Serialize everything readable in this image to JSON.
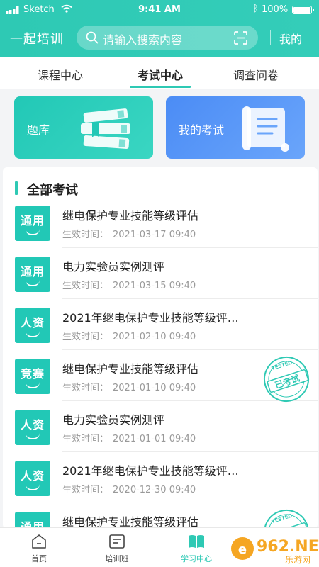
{
  "status_bar": {
    "carrier": "Sketch",
    "time": "9:41 AM",
    "battery": "100%",
    "icons": [
      "signal-icon",
      "wifi-icon",
      "bluetooth-icon",
      "battery-icon"
    ]
  },
  "header": {
    "title": "一起培训",
    "search_placeholder": "请输入搜索内容",
    "mine": "我的",
    "icons": [
      "search-icon",
      "scan-icon"
    ],
    "color": "#2ec9b4"
  },
  "tabs": [
    {
      "label": "课程中心",
      "active": false
    },
    {
      "label": "考试中心",
      "active": true
    },
    {
      "label": "调查问卷",
      "active": false
    }
  ],
  "cards": {
    "bank": {
      "label": "题库",
      "icon": "books-icon"
    },
    "my_exam": {
      "label": "我的考试",
      "icon": "scroll-icon"
    }
  },
  "section": {
    "title": "全部考试",
    "time_label": "生效时间："
  },
  "exams": [
    {
      "badge": "通用",
      "name": "继电保护专业技能等级评估",
      "time": "2021-03-17 09:40",
      "tested": false
    },
    {
      "badge": "通用",
      "name": "电力实验员实例测评",
      "time": "2021-03-15 09:40",
      "tested": false
    },
    {
      "badge": "人资",
      "name": "2021年继电保护专业技能等级评…",
      "time": "2021-02-10 09:40",
      "tested": false
    },
    {
      "badge": "竞赛",
      "name": "继电保护专业技能等级评估",
      "time": "2021-01-10 09:40",
      "tested": true
    },
    {
      "badge": "人资",
      "name": "电力实验员实例测评",
      "time": "2021-01-01 09:40",
      "tested": false
    },
    {
      "badge": "人资",
      "name": "2021年继电保护专业技能等级评…",
      "time": "2020-12-30 09:40",
      "tested": false
    },
    {
      "badge": "通用",
      "name": "继电保护专业技能等级评估",
      "time": "",
      "tested": true
    }
  ],
  "stamp": {
    "top_text": "TESTED",
    "main_text": "已考试",
    "color": "#2ec9b4"
  },
  "bottom_nav": [
    {
      "label": "首页",
      "icon": "home-icon",
      "active": false
    },
    {
      "label": "培训班",
      "icon": "class-icon",
      "active": false
    },
    {
      "label": "学习中心",
      "icon": "book-icon",
      "active": true
    }
  ],
  "watermark": {
    "text": "962.NET",
    "subtext": "乐游网"
  }
}
